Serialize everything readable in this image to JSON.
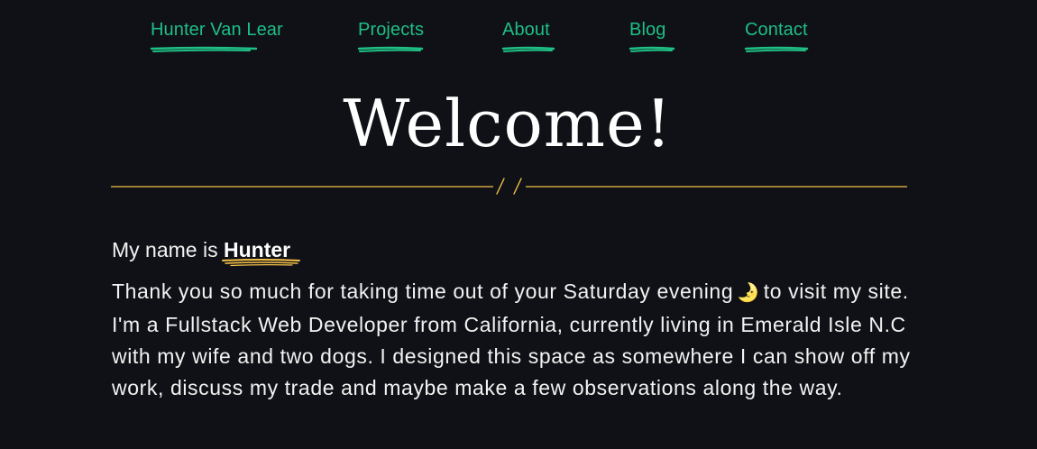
{
  "nav": {
    "items": [
      {
        "label": "Hunter Van Lear"
      },
      {
        "label": "Projects"
      },
      {
        "label": "About"
      },
      {
        "label": "Blog"
      },
      {
        "label": "Contact"
      }
    ]
  },
  "hero": {
    "title": "Welcome!"
  },
  "intro": {
    "prefix": "My name is ",
    "name": "Hunter"
  },
  "bio": {
    "before_icon": "Thank you so much for taking time out of your Saturday evening",
    "icon": "moon-icon",
    "after_icon": "to visit my site. I'm a Fullstack Web Developer from California, currently living in Emerald Isle N.C with my wife and two dogs. I designed this space as somewhere I can show off my work, discuss my trade and maybe make a few observations along the way."
  },
  "colors": {
    "background": "#0f1116",
    "accent_green": "#1fbf86",
    "accent_gold": "#f5c04a",
    "text": "#f2f2f2"
  }
}
